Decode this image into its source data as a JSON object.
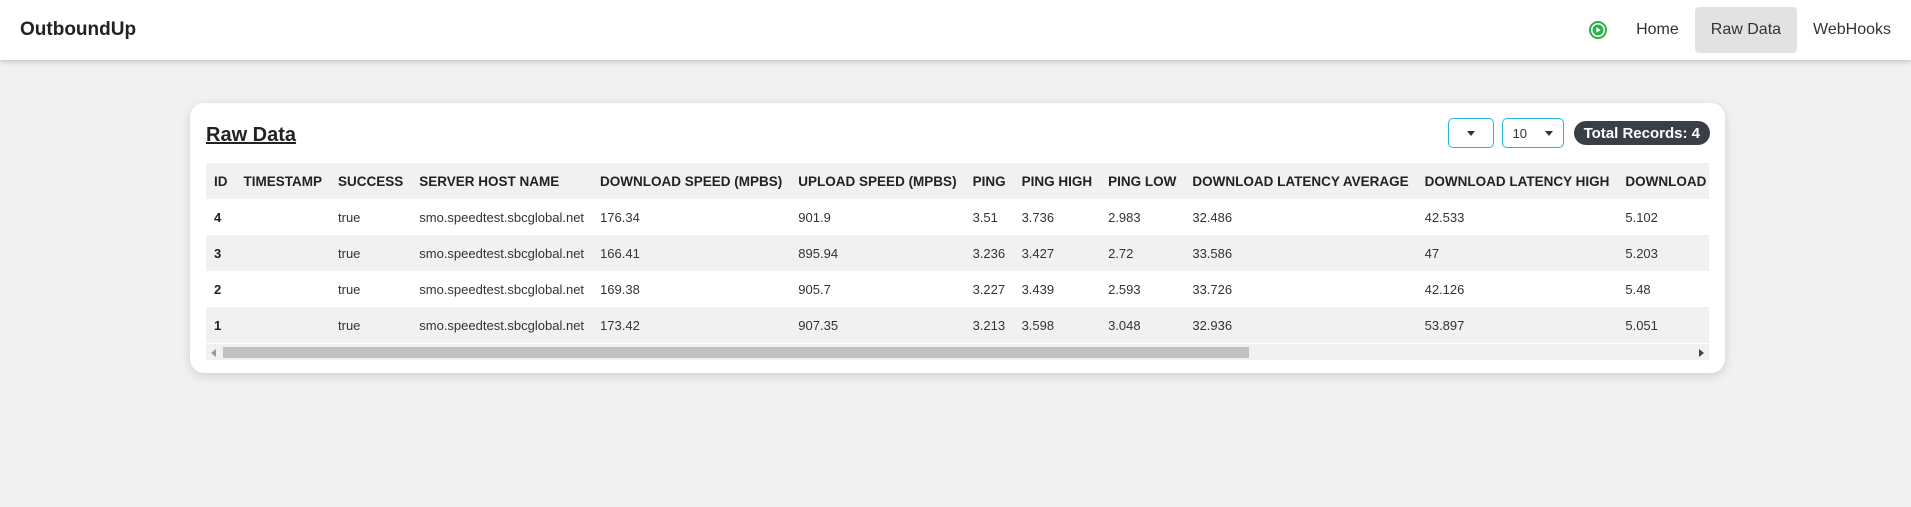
{
  "nav": {
    "brand": "OutboundUp",
    "links": [
      "Home",
      "Raw Data",
      "WebHooks"
    ],
    "status_icon": "play-circle-icon",
    "status_color": "#2bb24c"
  },
  "card": {
    "title": "Raw Data",
    "filter_select_value": "",
    "page_size": "10",
    "total_records": "Total Records: 4"
  },
  "table": {
    "headers": [
      "ID",
      "TIMESTAMP",
      "SUCCESS",
      "SERVER HOST NAME",
      "DOWNLOAD SPEED (MPBS)",
      "UPLOAD SPEED (MPBS)",
      "PING",
      "PING HIGH",
      "PING LOW",
      "DOWNLOAD LATENCY AVERAGE",
      "DOWNLOAD LATENCY HIGH",
      "DOWNLOAD"
    ],
    "rows": [
      [
        "4",
        "",
        "true",
        "smo.speedtest.sbcglobal.net",
        "176.34",
        "901.9",
        "3.51",
        "3.736",
        "2.983",
        "32.486",
        "42.533",
        "5.102"
      ],
      [
        "3",
        "",
        "true",
        "smo.speedtest.sbcglobal.net",
        "166.41",
        "895.94",
        "3.236",
        "3.427",
        "2.72",
        "33.586",
        "47",
        "5.203"
      ],
      [
        "2",
        "",
        "true",
        "smo.speedtest.sbcglobal.net",
        "169.38",
        "905.7",
        "3.227",
        "3.439",
        "2.593",
        "33.726",
        "42.126",
        "5.48"
      ],
      [
        "1",
        "",
        "true",
        "smo.speedtest.sbcglobal.net",
        "173.42",
        "907.35",
        "3.213",
        "3.598",
        "3.048",
        "32.936",
        "53.897",
        "5.051"
      ]
    ]
  }
}
